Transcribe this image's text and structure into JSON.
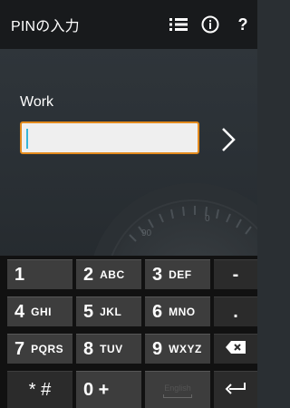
{
  "app_bar": {
    "title": "PINの入力",
    "icons": [
      "list-icon",
      "info-icon",
      "help-icon"
    ]
  },
  "form": {
    "label": "Work",
    "pin_value": ""
  },
  "dial": {
    "numbers": [
      "90",
      "0"
    ]
  },
  "keyboard": {
    "rows": [
      [
        {
          "main": "1",
          "sub": ""
        },
        {
          "main": "2",
          "sub": "ABC"
        },
        {
          "main": "3",
          "sub": "DEF"
        },
        {
          "main": "-",
          "sub": ""
        }
      ],
      [
        {
          "main": "4",
          "sub": "GHI"
        },
        {
          "main": "5",
          "sub": "JKL"
        },
        {
          "main": "6",
          "sub": "MNO"
        },
        {
          "main": ".",
          "sub": ""
        }
      ],
      [
        {
          "main": "7",
          "sub": "PQRS"
        },
        {
          "main": "8",
          "sub": "TUV"
        },
        {
          "main": "9",
          "sub": "WXYZ"
        },
        {
          "main": "",
          "sub": ""
        }
      ],
      [
        {
          "main": "* #",
          "sub": ""
        },
        {
          "main": "0 +",
          "sub": ""
        },
        {
          "main": "",
          "sub": "English"
        },
        {
          "main": "",
          "sub": ""
        }
      ]
    ]
  }
}
